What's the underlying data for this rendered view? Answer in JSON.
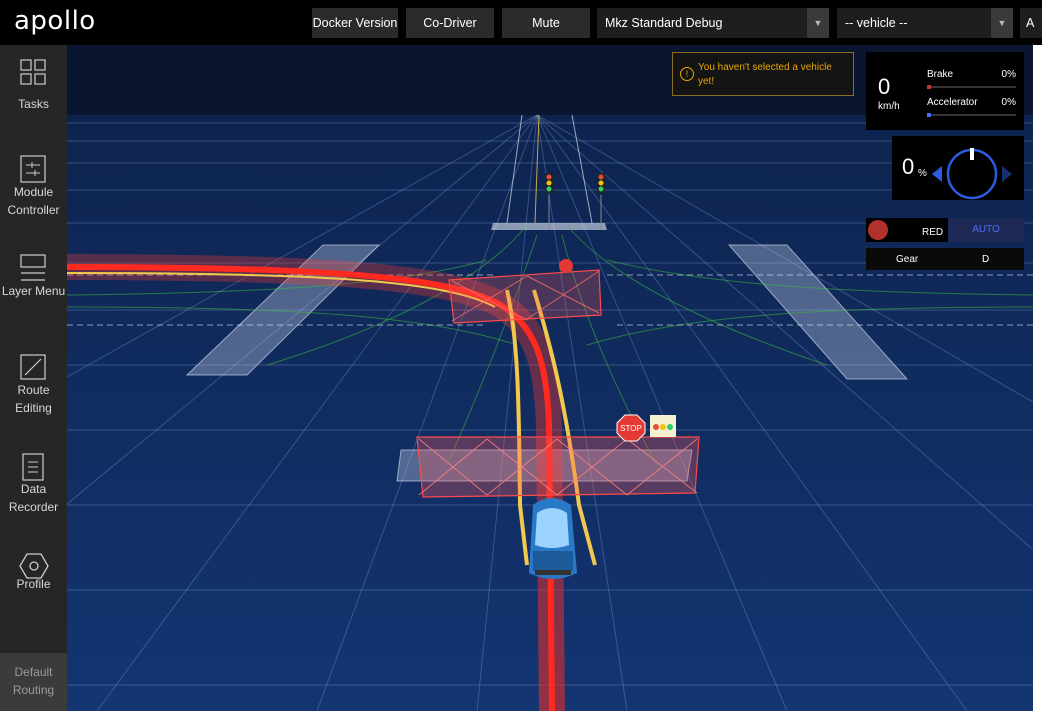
{
  "app": {
    "logo": "apollo"
  },
  "toolbar": {
    "docker_version": "Docker Version",
    "co_driver": "Co-Driver",
    "mute": "Mute",
    "mode_select": "Mkz Standard Debug",
    "vehicle_select": "-- vehicle --",
    "cut_off_select": "A"
  },
  "sidebar": {
    "items": [
      {
        "label": "Tasks",
        "icon": "tasks-icon"
      },
      {
        "label": "Module Controller",
        "icon": "module-controller-icon"
      },
      {
        "label": "Layer Menu",
        "icon": "layer-menu-icon"
      },
      {
        "label": "Route Editing",
        "icon": "route-editing-icon"
      },
      {
        "label": "Data Recorder",
        "icon": "data-recorder-icon"
      },
      {
        "label": "Profile",
        "icon": "profile-icon"
      }
    ],
    "bottom": {
      "label": "Default Routing"
    }
  },
  "notification": {
    "text": "You haven't selected a vehicle yet!",
    "icon": "warning-icon"
  },
  "dashboard": {
    "speed": "0",
    "speed_unit": "km/h",
    "brake_label": "Brake",
    "brake_value": "0%",
    "accelerator_label": "Accelerator",
    "accelerator_value": "0%",
    "steering_value": "0",
    "steering_unit": "%",
    "signal": "RED",
    "driving_mode": "AUTO",
    "gear_label": "Gear",
    "gear_value": "D"
  },
  "scene": {
    "stop_sign_label": "STOP"
  },
  "colors": {
    "accent_blue": "#4a6cf7",
    "warning": "#e6a600",
    "signal_red": "#b3312c",
    "brake_bar": "#c0392b",
    "scene_bg": "#0f2b62"
  }
}
